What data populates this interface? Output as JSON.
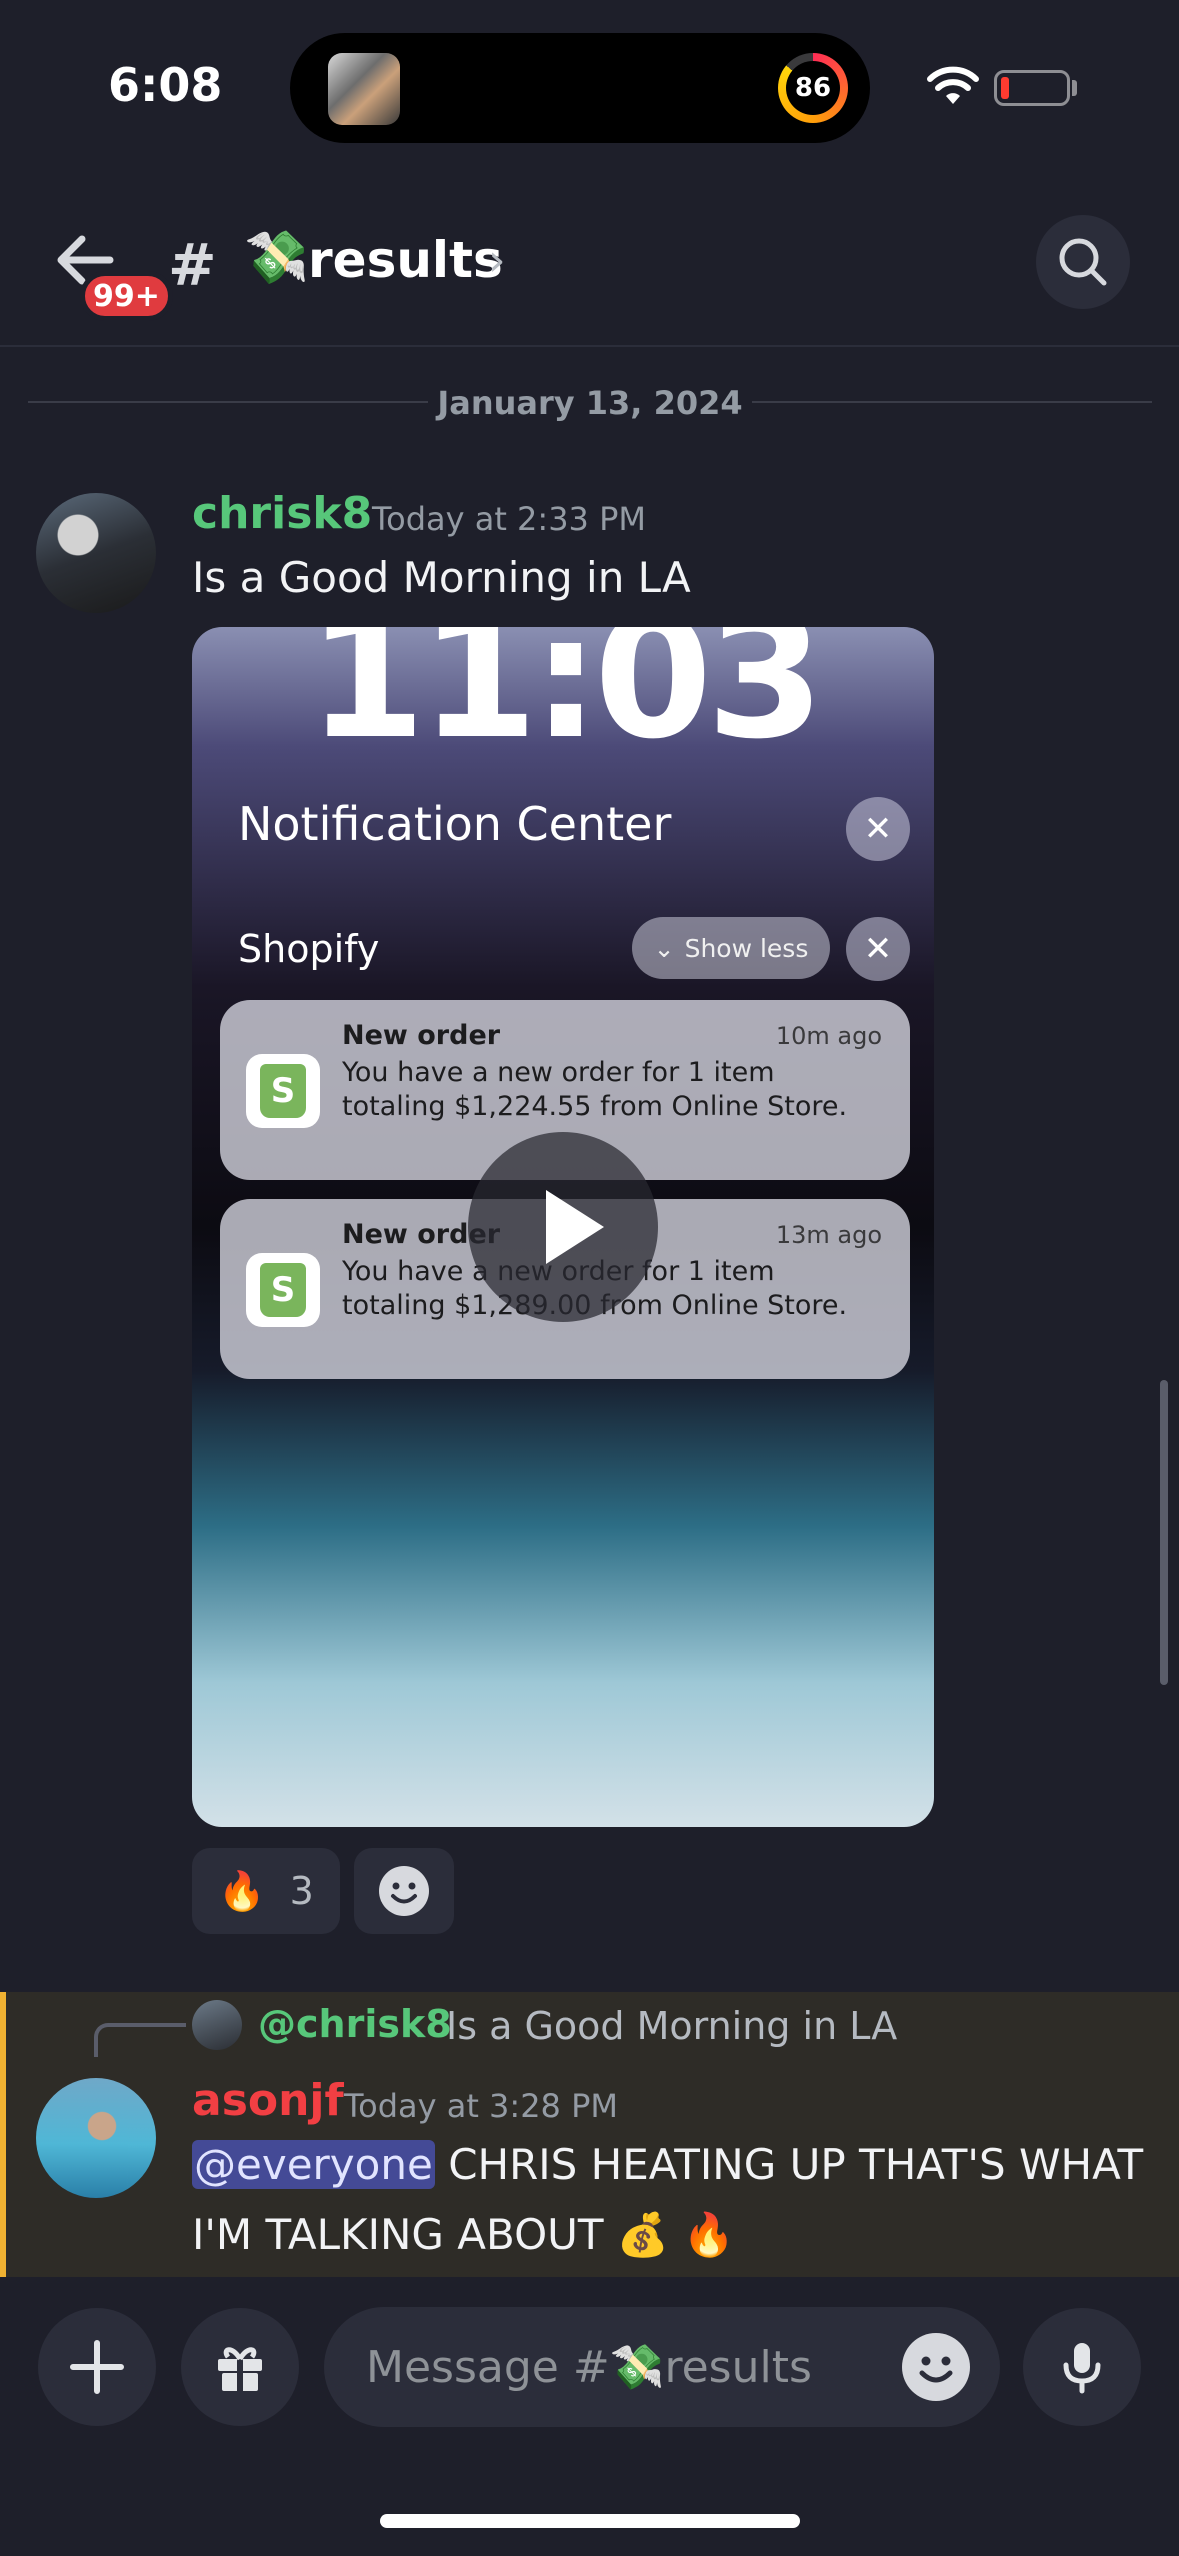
{
  "status_bar": {
    "time": "6:08",
    "activity_ring_value": "86"
  },
  "header": {
    "unread_badge": "99+",
    "channel_hash": "#",
    "channel_emoji": "💸",
    "channel_name": "results",
    "chevron": "›"
  },
  "date_divider": "January 13, 2024",
  "messages": [
    {
      "username": "chrisk8",
      "username_color": "#57c77a",
      "timestamp": "Today at 2:33 PM",
      "text": "Is a Good Morning in LA",
      "video": {
        "lock_time": "11:03",
        "notification_center_title": "Notification Center",
        "app_group": "Shopify",
        "show_less_label": "Show less",
        "notifications": [
          {
            "title": "New order",
            "time": "10m ago",
            "body": "You have a new order for 1 item totaling $1,224.55 from Online Store."
          },
          {
            "title": "New order",
            "time": "13m ago",
            "body": "You have a new order for 1 item totaling $1,289.00 from Online Store."
          }
        ]
      },
      "reactions": [
        {
          "emoji": "🔥",
          "count": "3"
        }
      ]
    },
    {
      "reply_to_user": "@chrisk8",
      "reply_to_text": "Is a Good Morning in LA",
      "username": "asonjf",
      "username_color": "#f23f43",
      "timestamp": "Today at 3:28 PM",
      "mention": "@everyone",
      "text_line1": "CHRIS HEATING UP THAT'S WHAT",
      "text_line2": "I'M TALKING ABOUT 💰 🔥"
    }
  ],
  "composer": {
    "placeholder": "Message #💸results"
  },
  "colors": {
    "background": "#1e1f2a",
    "highlight_bar": "#f0b232",
    "mention_bg": "#5865f2"
  }
}
